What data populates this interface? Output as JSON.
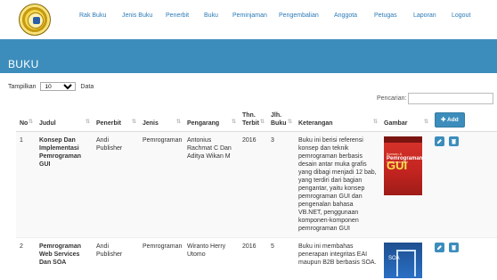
{
  "nav": {
    "items": [
      "Rak Buku",
      "Jenis Buku",
      "Penerbit",
      "Buku",
      "Peminjaman",
      "Pengembalian",
      "Anggota",
      "Petugas",
      "Laporan",
      "Logout"
    ]
  },
  "header": {
    "title": "BUKU"
  },
  "controls": {
    "show_label": "Tampilkan",
    "show_value": "10",
    "data_label": "Data",
    "search_label": "Pencarian:",
    "search_value": ""
  },
  "table": {
    "columns": [
      "No",
      "Judul",
      "Penerbit",
      "Jenis",
      "Pengarang",
      "Thn. Terbit",
      "Jlh. Buku",
      "Keterangan",
      "Gambar"
    ],
    "add_label": "Add",
    "rows": [
      {
        "no": "1",
        "judul": "Konsep Dan Implementasi Pemrograman GUI",
        "penerbit": "Andi Publisher",
        "jenis": "Pemrograman",
        "pengarang": "Antonius Rachmat C Dan Aditya Wikan M",
        "tahun": "2016",
        "jumlah": "3",
        "keterangan": "Buku ini berisi referensi konsep dan teknik pemrograman berbasis desain antar muka grafis yang dibagi menjadi 12 bab, yang terdiri dari bagian pengantar, yaitu konsep pemrograman GUI dan pengenalan bahasa VB.NET, penggunaan komponen-komponen pemrograman GUI",
        "cover_title": "Pemrograman",
        "cover_big": "GUI",
        "cover_small": "Konsep & Implementasi"
      },
      {
        "no": "2",
        "judul": "Pemrograman Web Services Dan SOA",
        "penerbit": "Andi Publisher",
        "jenis": "Pemrograman",
        "pengarang": "Wiranto Herry Utomo",
        "tahun": "2016",
        "jumlah": "5",
        "keterangan": "Buku ini membahas penerapan integritas EAI maupun B2B berbasis SOA.",
        "cover_small": "SOA"
      }
    ]
  }
}
